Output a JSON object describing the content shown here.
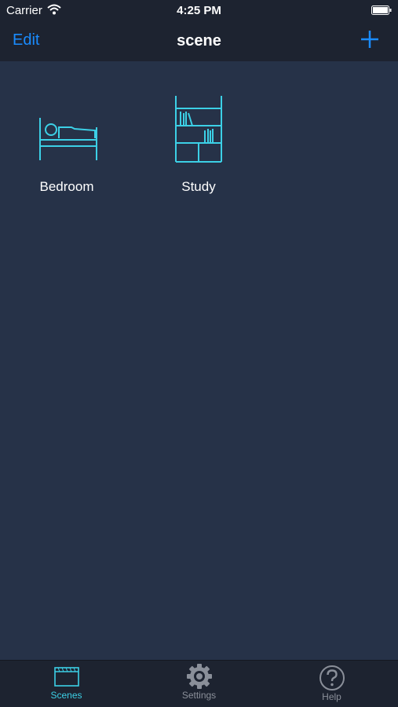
{
  "status_bar": {
    "carrier": "Carrier",
    "time": "4:25 PM",
    "icons": [
      "wifi-icon",
      "battery-icon"
    ]
  },
  "nav": {
    "edit_label": "Edit",
    "title": "scene",
    "add_icon": "plus-icon"
  },
  "scenes": [
    {
      "label": "Bedroom",
      "icon": "bed-icon"
    },
    {
      "label": "Study",
      "icon": "bookshelf-icon"
    }
  ],
  "tabbar": {
    "tabs": [
      {
        "label": "Scenes",
        "icon": "scenes-icon",
        "active": true
      },
      {
        "label": "Settings",
        "icon": "gear-icon",
        "active": false
      },
      {
        "label": "Help",
        "icon": "help-icon",
        "active": false
      }
    ]
  },
  "colors": {
    "background": "#263248",
    "bar": "#1d2330",
    "accent_blue": "#1a8cff",
    "icon_cyan": "#3cd0e6",
    "tab_inactive": "#8a8f99"
  }
}
